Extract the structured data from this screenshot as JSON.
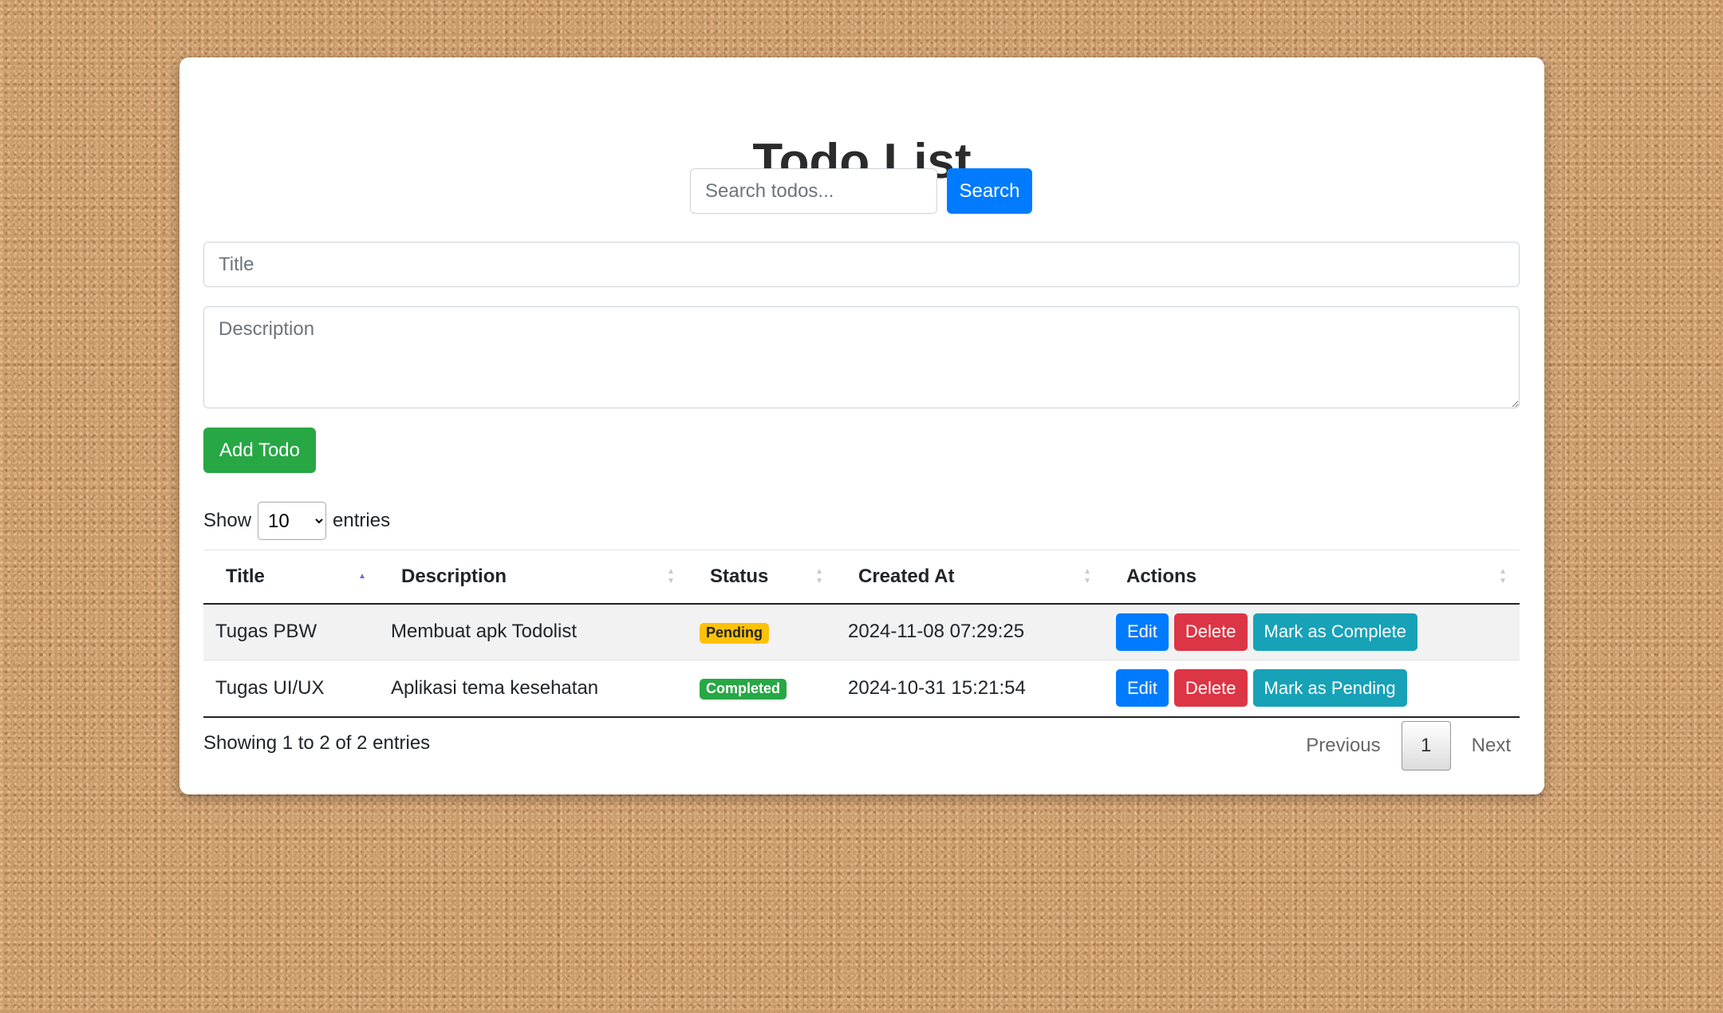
{
  "header": {
    "title": "Todo List"
  },
  "search": {
    "placeholder": "Search todos...",
    "button_label": "Search"
  },
  "form": {
    "title_placeholder": "Title",
    "description_placeholder": "Description",
    "add_label": "Add Todo"
  },
  "length": {
    "prefix": "Show",
    "value": "10",
    "suffix": "entries",
    "options": [
      "10"
    ]
  },
  "table": {
    "columns": [
      "Title",
      "Description",
      "Status",
      "Created At",
      "Actions"
    ],
    "sorted_column": "Title",
    "sort_direction": "ascending",
    "rows": [
      {
        "title": "Tugas PBW",
        "description": "Membuat apk Todolist",
        "status": "Pending",
        "status_color": "#ffc107",
        "created_at": "2024-11-08 07:29:25",
        "edit_label": "Edit",
        "delete_label": "Delete",
        "toggle_label": "Mark as Complete"
      },
      {
        "title": "Tugas UI/UX",
        "description": "Aplikasi tema kesehatan",
        "status": "Completed",
        "status_color": "#28a745",
        "created_at": "2024-10-31 15:21:54",
        "edit_label": "Edit",
        "delete_label": "Delete",
        "toggle_label": "Mark as Pending"
      }
    ]
  },
  "footer": {
    "info": "Showing 1 to 2 of 2 entries",
    "previous_label": "Previous",
    "current_page": "1",
    "next_label": "Next"
  },
  "colors": {
    "primary": "#007bff",
    "success": "#28a745",
    "danger": "#dc3545",
    "info": "#17a2b8",
    "warning": "#ffc107"
  }
}
